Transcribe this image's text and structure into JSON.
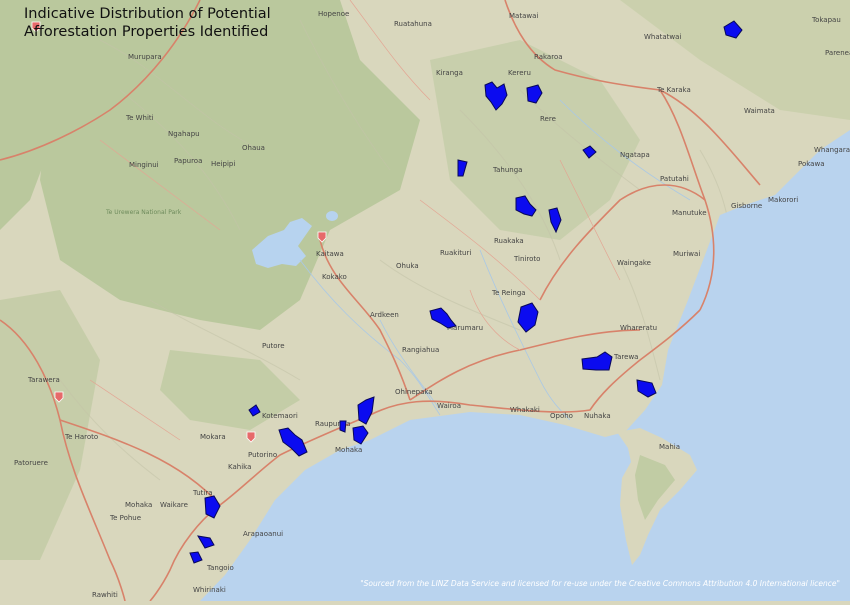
{
  "map": {
    "title": "Indicative Distribution of Potential\nAfforestation Properties Identified",
    "attribution": "\"Sourced from the LINZ Data Service and licensed for re-use under the Creative Commons Attribution 4.0 International licence\"",
    "colors": {
      "land": "#d9d7bd",
      "forest": "#b5c798",
      "water": "#b7d3ef",
      "roads": "#d8826a",
      "parcels": "#0b0bf0"
    },
    "place_names": [
      "Hopenoe",
      "Ruatahuna",
      "Matawai",
      "Tokapau",
      "Whatatwai",
      "Kiranga",
      "Kereru",
      "Rakaroa",
      "Murupara",
      "Te Whiti",
      "Ngahapu",
      "Te Karaka",
      "Rere",
      "Waimata",
      "Parenea",
      "Minginui",
      "Papuroa",
      "Heipipi",
      "Ohaua",
      "Ngatapa",
      "Tahunga",
      "Patutahi",
      "Whangara",
      "Pokawa",
      "Te Urewera National Park",
      "Manutuke",
      "Gisborne",
      "Makorori",
      "Kaitawa",
      "Ruakituri",
      "Ruakaka",
      "Tiniroto",
      "Muriwai",
      "Kokako",
      "Ohuka",
      "Wairoa",
      "Te Reinga",
      "Waingake",
      "Ardkeen",
      "Marumaru",
      "Whareratu",
      "Putore",
      "Rangiahua",
      "Tarewa",
      "Ohinepaka",
      "Tarawera",
      "Kotemaori",
      "Raupunga",
      "Whakaki",
      "Opoho",
      "Nuhaka",
      "Te Haroto",
      "Mokara",
      "Putorino",
      "Mohaka",
      "Mahia",
      "Patoruere",
      "Kahika",
      "Waikare",
      "Tutira",
      "Te Pohue",
      "Mohaka",
      "Arapaoanui",
      "Tangoio",
      "Whirinaki",
      "Rawhiti",
      "Nuhaka"
    ],
    "icons": [
      "highway-shield-icon"
    ]
  }
}
